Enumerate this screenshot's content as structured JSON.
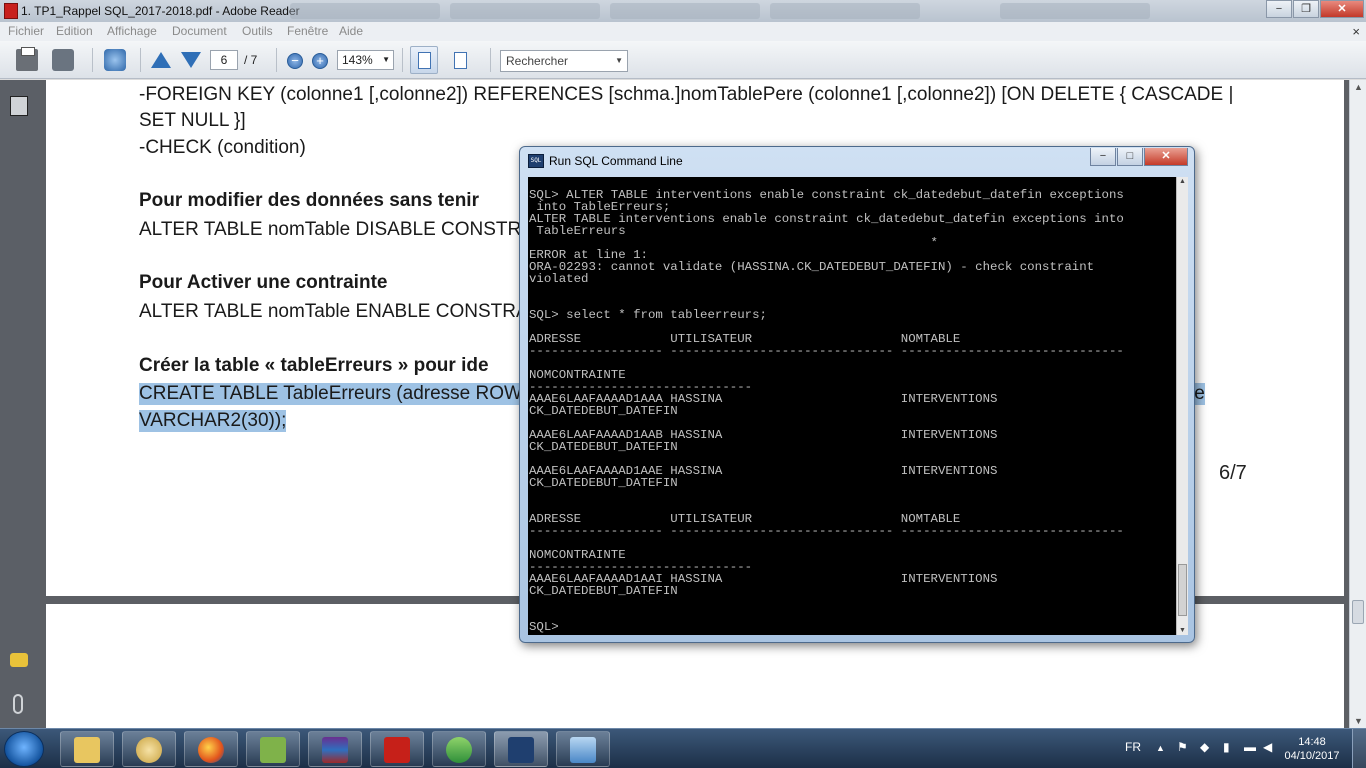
{
  "window": {
    "title": "1. TP1_Rappel SQL_2017-2018.pdf - Adobe Reader",
    "minimize": "−",
    "maximize": "❐",
    "close": "✕"
  },
  "menu": {
    "items": [
      "Fichier",
      "Edition",
      "Affichage",
      "Document",
      "Outils",
      "Fenêtre",
      "Aide"
    ],
    "close": "×"
  },
  "toolbar": {
    "page_current": "6",
    "page_total": "/ 7",
    "zoom": "143%",
    "zoom_out": "−",
    "zoom_in": "+",
    "search_placeholder": "Rechercher",
    "dropdown": "▼"
  },
  "document": {
    "lines": [
      "-FOREIGN KEY (colonne1 [,colonne2]) REFERENCES [schma.]nomTablePere (colonne1 [,colonne2]) [ON DELETE { CASCADE |",
      "SET NULL }]",
      "-CHECK (condition)",
      "Pour  modifier des données sans tenir",
      "ALTER TABLE nomTable DISABLE CONSTRAI",
      "Pour Activer une contrainte",
      "ALTER TABLE nomTable ENABLE CONSTRAI",
      "Créer la table « tableErreurs » pour ide",
      "CREATE TABLE TableErreurs   (adresse ROW",
      "te",
      "VARCHAR2(30));"
    ],
    "page_number": "6/7"
  },
  "sql_window": {
    "title": "Run SQL Command Line",
    "icon_label": "SQL",
    "minimize": "−",
    "maximize": "□",
    "close": "✕",
    "console_text": "SQL> ALTER TABLE interventions enable constraint ck_datedebut_datefin exceptions\n into TableErreurs;\nALTER TABLE interventions enable constraint ck_datedebut_datefin exceptions into\n TableErreurs\n                                                      *\nERROR at line 1:\nORA-02293: cannot validate (HASSINA.CK_DATEDEBUT_DATEFIN) - check constraint\nviolated\n\n\nSQL> select * from tableerreurs;\n\nADRESSE            UTILISATEUR                    NOMTABLE\n------------------ ------------------------------ ------------------------------\n\nNOMCONTRAINTE\n------------------------------\nAAAE6LAAFAAAAD1AAA HASSINA                        INTERVENTIONS\nCK_DATEDEBUT_DATEFIN\n\nAAAE6LAAFAAAAD1AAB HASSINA                        INTERVENTIONS\nCK_DATEDEBUT_DATEFIN\n\nAAAE6LAAFAAAAD1AAE HASSINA                        INTERVENTIONS\nCK_DATEDEBUT_DATEFIN\n\n\nADRESSE            UTILISATEUR                    NOMTABLE\n------------------ ------------------------------ ------------------------------\n\nNOMCONTRAINTE\n------------------------------\nAAAE6LAAFAAAAD1AAI HASSINA                        INTERVENTIONS\nCK_DATEDEBUT_DATEFIN\n\n\nSQL>"
  },
  "taskbar": {
    "language": "FR",
    "time": "14:48",
    "date": "04/10/2017"
  },
  "colors": {
    "highlight": "#9ec2e4",
    "taskbar": "#2a4363",
    "console_bg": "#000000",
    "console_fg": "#c0c0c0"
  }
}
